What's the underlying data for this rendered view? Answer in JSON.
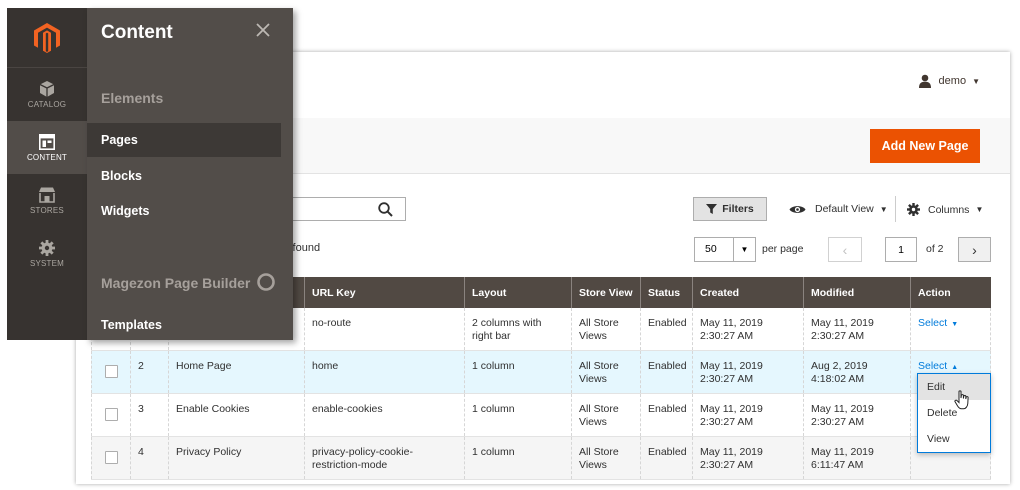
{
  "header": {
    "user_name": "demo"
  },
  "toolbar": {
    "add_new_page": "Add New Page"
  },
  "controls": {
    "filters": "Filters",
    "default_view": "Default View",
    "columns": "Columns",
    "records_found": "s found",
    "per_page_value": "50",
    "per_page_label": "per page",
    "current_page": "1",
    "page_total": "of 2"
  },
  "grid": {
    "columns": [
      "URL Key",
      "Layout",
      "Store View",
      "Status",
      "Created",
      "Modified",
      "Action"
    ],
    "rows": [
      {
        "id": "",
        "title": "",
        "url_key": "no-route",
        "layout": "2 columns with right bar",
        "store_view": "All Store Views",
        "status": "Enabled",
        "created": "May 11, 2019 2:30:27 AM",
        "modified": "May 11, 2019 2:30:27 AM",
        "action": "Select"
      },
      {
        "id": "2",
        "title": "Home Page",
        "url_key": "home",
        "layout": "1 column",
        "store_view": "All Store Views",
        "status": "Enabled",
        "created": "May 11, 2019 2:30:27 AM",
        "modified": "Aug 2, 2019 4:18:02 AM",
        "action": "Select"
      },
      {
        "id": "3",
        "title": "Enable Cookies",
        "url_key": "enable-cookies",
        "layout": "1 column",
        "store_view": "All Store Views",
        "status": "Enabled",
        "created": "May 11, 2019 2:30:27 AM",
        "modified": "May 11, 2019 2:30:27 AM",
        "action": ""
      },
      {
        "id": "4",
        "title": "Privacy Policy",
        "url_key": "privacy-policy-cookie-restriction-mode",
        "layout": "1 column",
        "store_view": "All Store Views",
        "status": "Enabled",
        "created": "May 11, 2019 2:30:27 AM",
        "modified": "May 11, 2019 6:11:47 AM",
        "action": ""
      }
    ]
  },
  "action_menu": {
    "items": [
      "Edit",
      "Delete",
      "View"
    ]
  },
  "sidebar": {
    "items": [
      {
        "label": "CATALOG"
      },
      {
        "label": "CONTENT"
      },
      {
        "label": "STORES"
      },
      {
        "label": "SYSTEM"
      }
    ]
  },
  "flyout": {
    "title": "Content",
    "group_elements": "Elements",
    "links_elements": [
      "Pages",
      "Blocks",
      "Widgets"
    ],
    "group_builder": "Magezon Page Builder",
    "links_builder": [
      "Templates"
    ]
  },
  "colors": {
    "accent": "#eb5202",
    "sidebar": "#373330",
    "flyout": "#524d49",
    "grid_header": "#514943",
    "link": "#007bdb"
  }
}
